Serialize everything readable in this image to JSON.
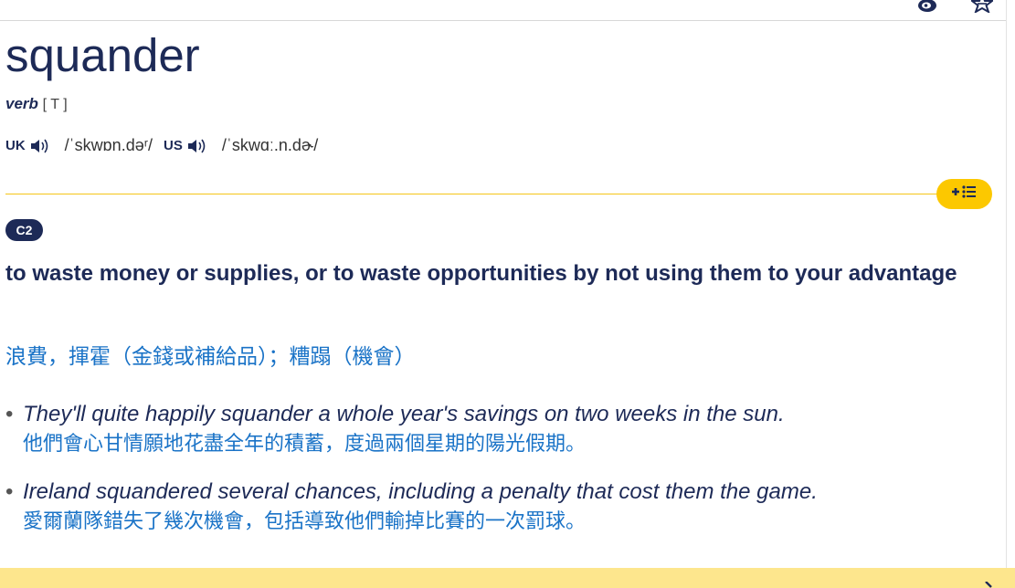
{
  "entry": {
    "headword": "squander",
    "pos": "verb",
    "grammar": "[ T ]",
    "level": "C2"
  },
  "pronunciation": {
    "uk_label": "UK",
    "uk_ipa": "/ˈskwɒn.dəʳ/",
    "us_label": "US",
    "us_ipa": "/ˈskwɑː.n.dɚ/"
  },
  "definition": {
    "text": "to waste money or supplies, or to waste opportunities by not using them to your advantage",
    "translation": "浪費，揮霍（金錢或補給品）；糟蹋（機會）"
  },
  "examples": [
    {
      "text": "They'll quite happily squander a whole year's savings on two weeks in the sun.",
      "translation": "他們會心甘情願地花盡全年的積蓄，度過兩個星期的陽光假期。"
    },
    {
      "text": "Ireland squandered several chances, including a penalty that cost them the game.",
      "translation": "愛爾蘭隊錯失了幾次機會，包括導致他們輸掉比賽的一次罰球。"
    }
  ],
  "toolbar": {
    "add_to_list_icon": "plus-list-icon",
    "share_icon": "weibo-icon",
    "favorite_icon": "star-icon"
  },
  "colors": {
    "navy": "#1d2a57",
    "translation_blue": "#1a73c7",
    "accent_yellow": "#fcc800",
    "band_yellow": "#fde68d"
  }
}
